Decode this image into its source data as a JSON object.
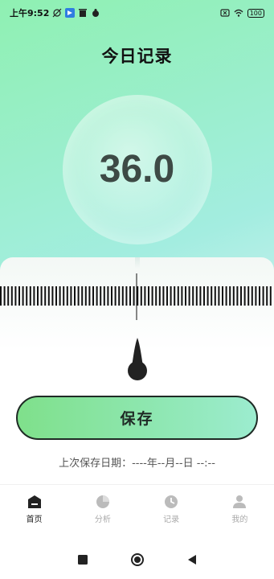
{
  "status_bar": {
    "time": "上午9:52",
    "battery": "100"
  },
  "header": {
    "title": "今日记录"
  },
  "reading": {
    "value": "36.0"
  },
  "save": {
    "label": "保存"
  },
  "last_saved": {
    "text": "上次保存日期：----年--月--日 --:--"
  },
  "tabs": [
    {
      "label": "首页",
      "icon": "home-icon",
      "active": true
    },
    {
      "label": "分析",
      "icon": "pie-chart-icon",
      "active": false
    },
    {
      "label": "记录",
      "icon": "clock-icon",
      "active": false
    },
    {
      "label": "我的",
      "icon": "user-icon",
      "active": false
    }
  ],
  "nav": {
    "icons": [
      "square-icon",
      "circle-icon",
      "triangle-back-icon"
    ]
  },
  "colors": {
    "accent_green": "#7fe08b",
    "dark": "#1f2a25",
    "value_text": "#3d4a45"
  }
}
